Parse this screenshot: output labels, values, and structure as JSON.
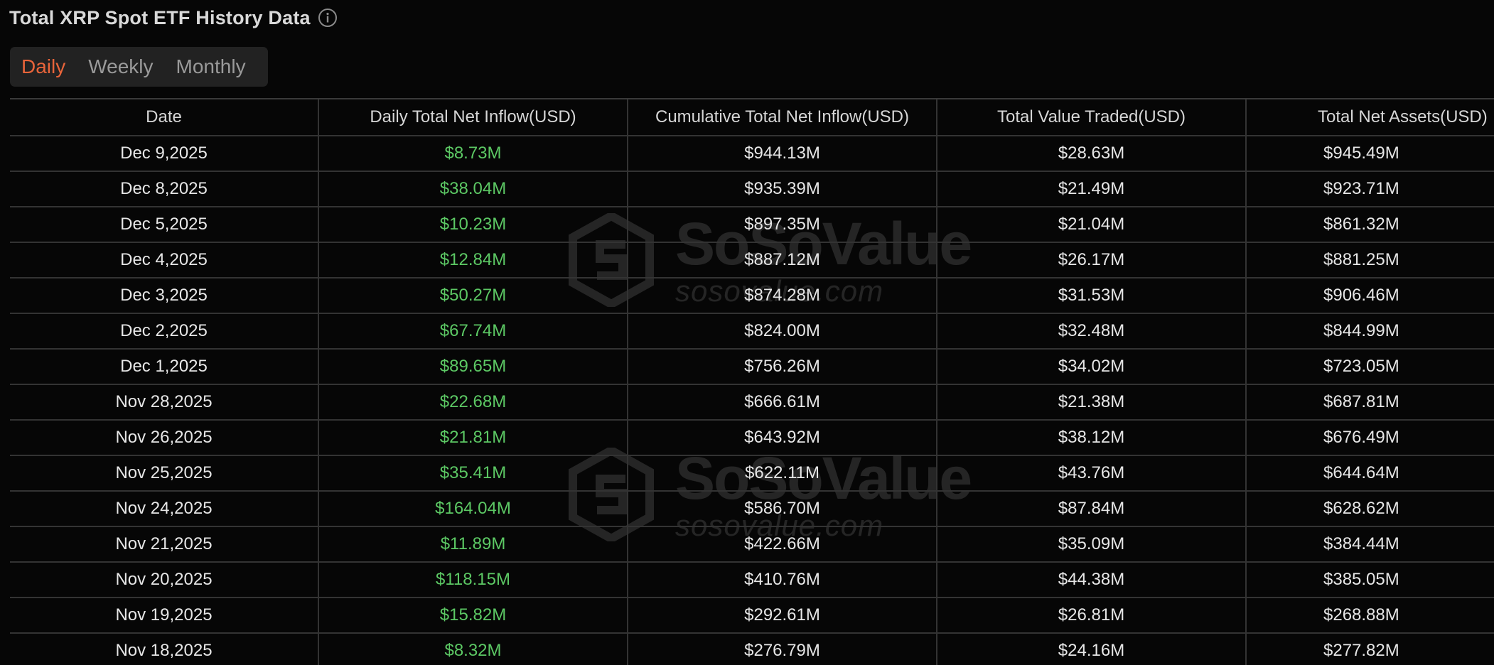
{
  "header": {
    "title": "Total XRP Spot ETF History Data",
    "info_icon": "info-circle-icon"
  },
  "tabs": [
    {
      "label": "Daily",
      "active": true
    },
    {
      "label": "Weekly",
      "active": false
    },
    {
      "label": "Monthly",
      "active": false
    }
  ],
  "table": {
    "columns": [
      "Date",
      "Daily Total Net Inflow(USD)",
      "Cumulative Total Net Inflow(USD)",
      "Total Value Traded(USD)",
      "Total Net Assets(USD)"
    ],
    "rows": [
      [
        "Dec 9,2025",
        "$8.73M",
        "$944.13M",
        "$28.63M",
        "$945.49M"
      ],
      [
        "Dec 8,2025",
        "$38.04M",
        "$935.39M",
        "$21.49M",
        "$923.71M"
      ],
      [
        "Dec 5,2025",
        "$10.23M",
        "$897.35M",
        "$21.04M",
        "$861.32M"
      ],
      [
        "Dec 4,2025",
        "$12.84M",
        "$887.12M",
        "$26.17M",
        "$881.25M"
      ],
      [
        "Dec 3,2025",
        "$50.27M",
        "$874.28M",
        "$31.53M",
        "$906.46M"
      ],
      [
        "Dec 2,2025",
        "$67.74M",
        "$824.00M",
        "$32.48M",
        "$844.99M"
      ],
      [
        "Dec 1,2025",
        "$89.65M",
        "$756.26M",
        "$34.02M",
        "$723.05M"
      ],
      [
        "Nov 28,2025",
        "$22.68M",
        "$666.61M",
        "$21.38M",
        "$687.81M"
      ],
      [
        "Nov 26,2025",
        "$21.81M",
        "$643.92M",
        "$38.12M",
        "$676.49M"
      ],
      [
        "Nov 25,2025",
        "$35.41M",
        "$622.11M",
        "$43.76M",
        "$644.64M"
      ],
      [
        "Nov 24,2025",
        "$164.04M",
        "$586.70M",
        "$87.84M",
        "$628.62M"
      ],
      [
        "Nov 21,2025",
        "$11.89M",
        "$422.66M",
        "$35.09M",
        "$384.44M"
      ],
      [
        "Nov 20,2025",
        "$118.15M",
        "$410.76M",
        "$44.38M",
        "$385.05M"
      ],
      [
        "Nov 19,2025",
        "$15.82M",
        "$292.61M",
        "$26.81M",
        "$268.88M"
      ],
      [
        "Nov 18,2025",
        "$8.32M",
        "$276.79M",
        "$24.16M",
        "$277.82M"
      ]
    ]
  },
  "watermark": {
    "brand": "SoSoValue",
    "url": "sosovalue.com",
    "icon": "sosovalue-logo-icon"
  },
  "colors": {
    "accent": "#e8643a",
    "positive": "#5cc864",
    "background": "#060606",
    "tab_bg": "#222222"
  }
}
